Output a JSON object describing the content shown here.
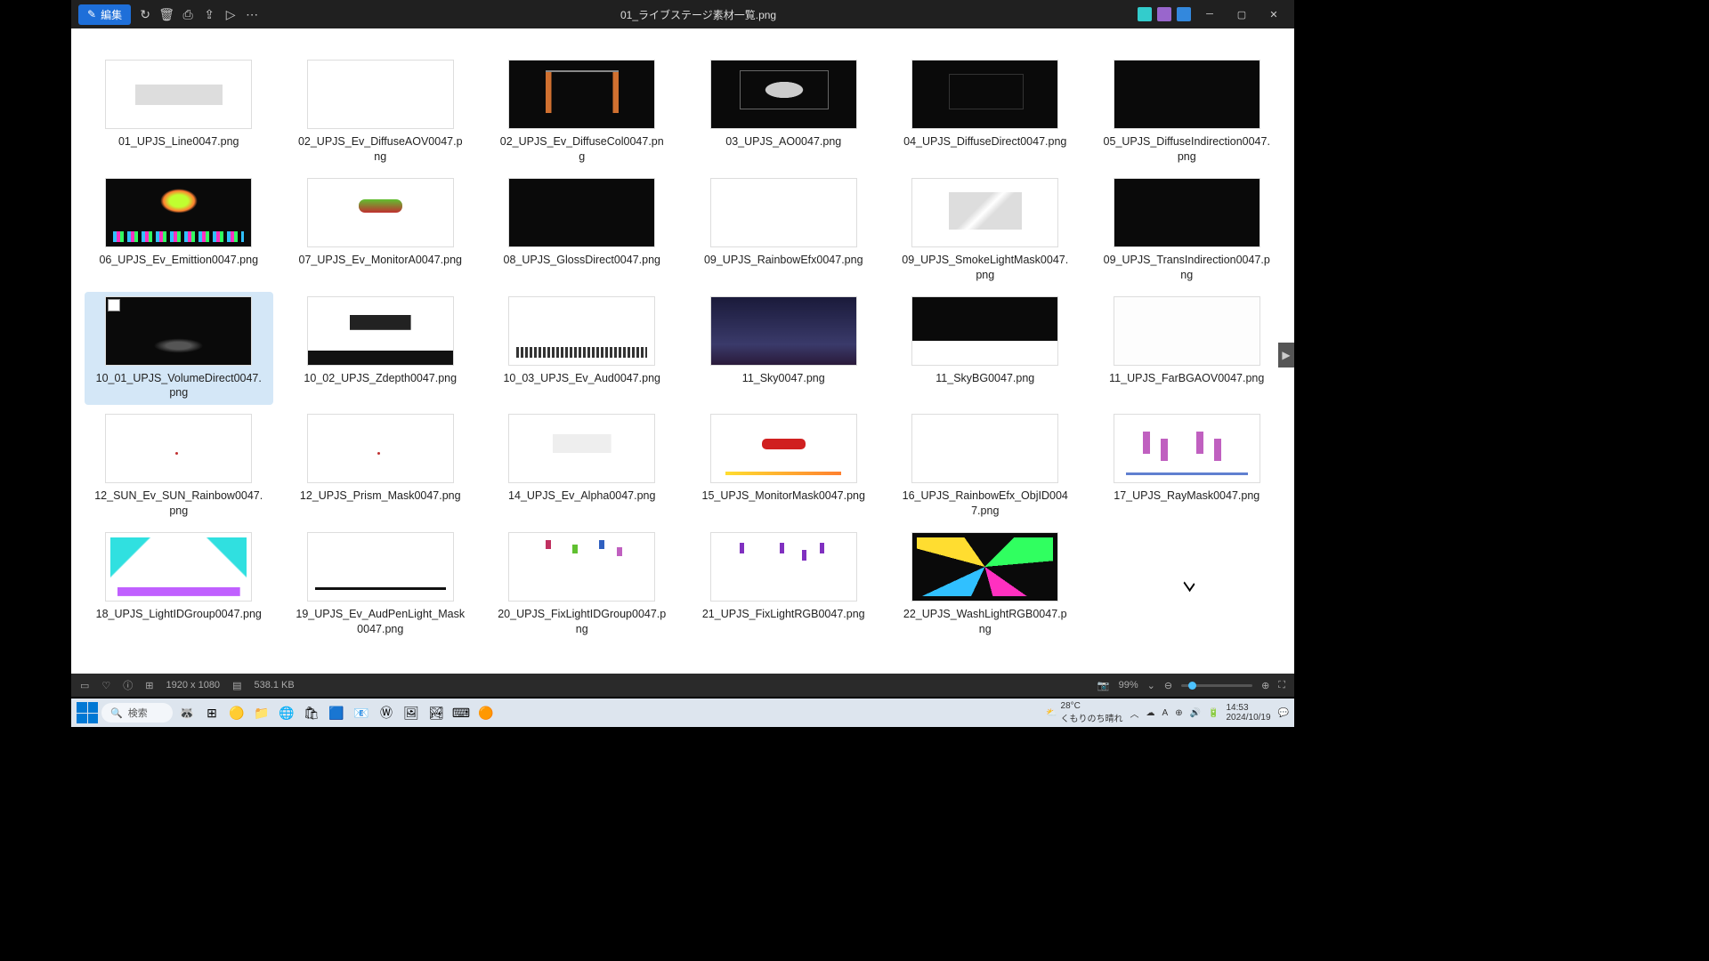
{
  "window": {
    "title": "01_ライブステージ素材一覧.png",
    "edit_label": "編集"
  },
  "files": [
    {
      "name": "01_UPJS_Line0047.png",
      "t": "t1"
    },
    {
      "name": "02_UPJS_Ev_DiffuseAOV0047.png",
      "t": "t2"
    },
    {
      "name": "02_UPJS_Ev_DiffuseCol0047.png",
      "t": "t3"
    },
    {
      "name": "03_UPJS_AO0047.png",
      "t": "t4"
    },
    {
      "name": "04_UPJS_DiffuseDirect0047.png",
      "t": "t5"
    },
    {
      "name": "05_UPJS_DiffuseIndirection0047.png",
      "t": "t6"
    },
    {
      "name": "06_UPJS_Ev_Emittion0047.png",
      "t": "t7"
    },
    {
      "name": "07_UPJS_Ev_MonitorA0047.png",
      "t": "t8"
    },
    {
      "name": "08_UPJS_GlossDirect0047.png",
      "t": "t9"
    },
    {
      "name": "09_UPJS_RainbowEfx0047.png",
      "t": "t10"
    },
    {
      "name": "09_UPJS_SmokeLightMask0047.png",
      "t": "t11"
    },
    {
      "name": "09_UPJS_TransIndirection0047.png",
      "t": "t12"
    },
    {
      "name": "10_01_UPJS_VolumeDirect0047.png",
      "t": "t13",
      "selected": true
    },
    {
      "name": "10_02_UPJS_Zdepth0047.png",
      "t": "t14"
    },
    {
      "name": "10_03_UPJS_Ev_Aud0047.png",
      "t": "t15"
    },
    {
      "name": "11_Sky0047.png",
      "t": "t16"
    },
    {
      "name": "11_SkyBG0047.png",
      "t": "t17"
    },
    {
      "name": "11_UPJS_FarBGAOV0047.png",
      "t": "t18"
    },
    {
      "name": "12_SUN_Ev_SUN_Rainbow0047.png",
      "t": "t19"
    },
    {
      "name": "12_UPJS_Prism_Mask0047.png",
      "t": "t20"
    },
    {
      "name": "14_UPJS_Ev_Alpha0047.png",
      "t": "t21"
    },
    {
      "name": "15_UPJS_MonitorMask0047.png",
      "t": "t22"
    },
    {
      "name": "16_UPJS_RainbowEfx_ObjID0047.png",
      "t": "t23"
    },
    {
      "name": "17_UPJS_RayMask0047.png",
      "t": "t24"
    },
    {
      "name": "18_UPJS_LightIDGroup0047.png",
      "t": "t25"
    },
    {
      "name": "19_UPJS_Ev_AudPenLight_Mask0047.png",
      "t": "t26"
    },
    {
      "name": "20_UPJS_FixLightIDGroup0047.png",
      "t": "t27"
    },
    {
      "name": "21_UPJS_FixLightRGB0047.png",
      "t": "t28"
    },
    {
      "name": "22_UPJS_WashLightRGB0047.png",
      "t": "t29"
    }
  ],
  "status": {
    "dimensions": "1920 x 1080",
    "filesize": "538.1 KB",
    "zoom": "99%"
  },
  "taskbar": {
    "search_placeholder": "検索",
    "weather_temp": "28°C",
    "weather_desc": "くもりのち晴れ",
    "time": "14:53",
    "date": "2024/10/19"
  }
}
